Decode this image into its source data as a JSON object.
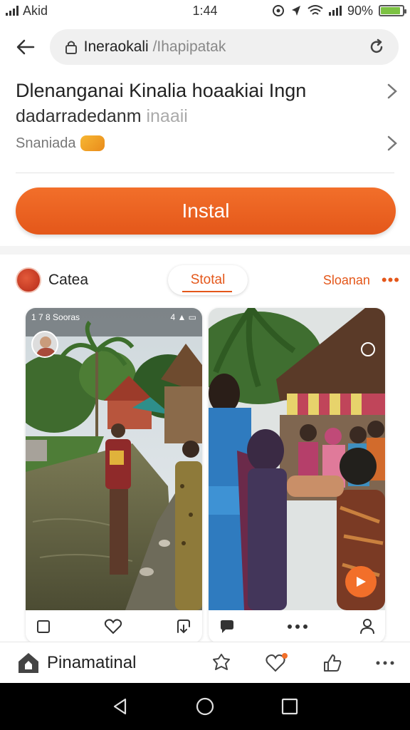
{
  "status_bar": {
    "carrier": "Akid",
    "time": "1:44",
    "battery": "90%",
    "battery_level": 0.9
  },
  "address_bar": {
    "url_main": "Ineraokali",
    "url_rest": " /Ihapipatak"
  },
  "header": {
    "title_line1": "Dlenanganai Kinalia hoaakiai Ingn",
    "title_line2_main": "dadarradedanm",
    "title_line2_faint": " inaaii",
    "subtitle": "Snaniada"
  },
  "install_button": {
    "label": "Instal"
  },
  "category_row": {
    "label": "Catea",
    "tab_label": "Stotal",
    "right_label": "Sloanan",
    "more_label": "•••"
  },
  "card_1": {
    "mini_status_left": "1 7 8 Sooras",
    "mini_status_right": "4 ▲ ▭"
  },
  "bottom_bar": {
    "title": "Pinamatinal"
  },
  "colors": {
    "accent": "#e4571a",
    "install_gradient_top": "#f26f2a",
    "battery_fill": "#7cc243"
  },
  "icons": [
    "back-arrow-icon",
    "lock-icon",
    "reload-icon",
    "chevron-right-icon",
    "bookmark-icon",
    "heart-icon",
    "share-icon",
    "comment-icon",
    "more-icon",
    "profile-icon",
    "home-icon",
    "puzzle-icon",
    "like-icon",
    "nav-back-icon",
    "nav-home-icon",
    "nav-recents-icon"
  ]
}
